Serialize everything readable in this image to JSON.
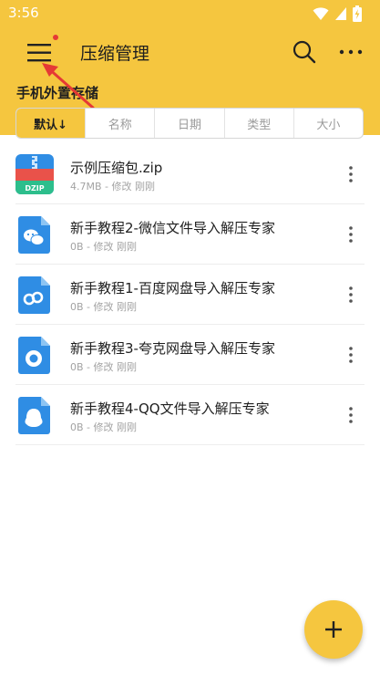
{
  "status_bar": {
    "time": "3:56"
  },
  "toolbar": {
    "title": "压缩管理"
  },
  "storage": {
    "label": "手机外置存储"
  },
  "sort": {
    "tabs": [
      {
        "label": "默认↓"
      },
      {
        "label": "名称"
      },
      {
        "label": "日期"
      },
      {
        "label": "类型"
      },
      {
        "label": "大小"
      }
    ],
    "active_index": 0
  },
  "files": [
    {
      "name": "示例压缩包.zip",
      "meta": "4.7MB - 修改 刚刚",
      "icon": "zip-icon"
    },
    {
      "name": "新手教程2-微信文件导入解压专家",
      "meta": "0B - 修改 刚刚",
      "icon": "wechat-file-icon"
    },
    {
      "name": "新手教程1-百度网盘导入解压专家",
      "meta": "0B - 修改 刚刚",
      "icon": "baidu-netdisk-file-icon"
    },
    {
      "name": "新手教程3-夸克网盘导入解压专家",
      "meta": "0B - 修改 刚刚",
      "icon": "quark-file-icon"
    },
    {
      "name": "新手教程4-QQ文件导入解压专家",
      "meta": "0B - 修改 刚刚",
      "icon": "qq-file-icon"
    }
  ],
  "colors": {
    "accent": "#F5C63F",
    "zip_blue": "#2F8DE4",
    "zip_red": "#E9524A",
    "zip_green": "#2DBE8C",
    "file_blue": "#2F8DE4",
    "annotation_red": "#E53935"
  }
}
